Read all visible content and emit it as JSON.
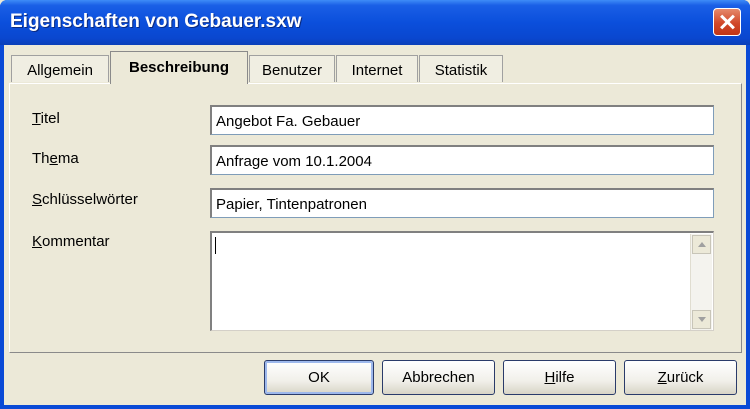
{
  "window": {
    "title": "Eigenschaften von Gebauer.sxw"
  },
  "tabs": [
    {
      "label": "Allgemein"
    },
    {
      "label": "Beschreibung"
    },
    {
      "label": "Benutzer"
    },
    {
      "label": "Internet"
    },
    {
      "label": "Statistik"
    }
  ],
  "fields": {
    "titel": {
      "label": "Titel",
      "value": "Angebot Fa. Gebauer"
    },
    "thema": {
      "label": "Thema",
      "value": "Anfrage vom 10.1.2004"
    },
    "schluessel": {
      "label": "Schlüsselwörter",
      "value": "Papier, Tintenpatronen"
    },
    "kommentar": {
      "label": "Kommentar",
      "value": ""
    }
  },
  "buttons": {
    "ok": "OK",
    "cancel": "Abbrechen",
    "help": "Hilfe",
    "back": "Zurück"
  }
}
